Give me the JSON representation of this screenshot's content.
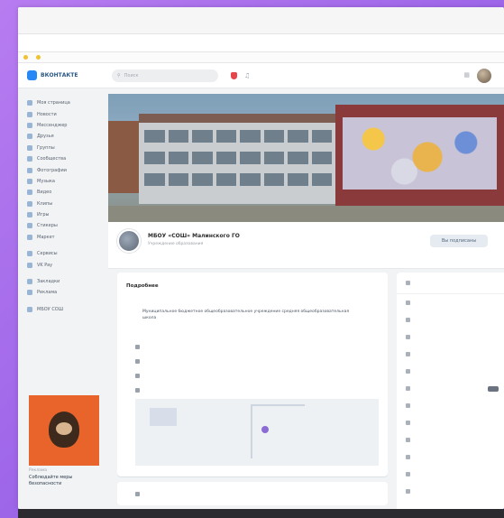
{
  "browser": {
    "address": "",
    "bookmarks": [
      "",
      ""
    ]
  },
  "header": {
    "logo_text": "ВКОНТАКТЕ",
    "search_placeholder": "Поиск"
  },
  "sidebar": {
    "items": [
      {
        "label": "Моя страница",
        "icon": "user-icon"
      },
      {
        "label": "Новости",
        "icon": "news-icon"
      },
      {
        "label": "Мессенджер",
        "icon": "chat-icon"
      },
      {
        "label": "Друзья",
        "icon": "friends-icon"
      },
      {
        "label": "Группы",
        "icon": "group-icon"
      },
      {
        "label": "Сообщества",
        "icon": "community-icon"
      },
      {
        "label": "Фотографии",
        "icon": "photo-icon"
      },
      {
        "label": "Музыка",
        "icon": "music-icon"
      },
      {
        "label": "Видео",
        "icon": "video-icon"
      },
      {
        "label": "Клипы",
        "icon": "clips-icon"
      },
      {
        "label": "Игры",
        "icon": "games-icon"
      },
      {
        "label": "Стикеры",
        "icon": "sticker-icon"
      },
      {
        "label": "Маркет",
        "icon": "market-icon"
      }
    ],
    "group2": [
      {
        "label": "Сервисы",
        "icon": "apps-icon"
      },
      {
        "label": "VK Pay",
        "icon": "wallet-icon"
      }
    ],
    "group3": [
      {
        "label": "Закладки",
        "icon": "bookmark-icon"
      },
      {
        "label": "Реклама",
        "icon": "ads-icon"
      }
    ],
    "extra": {
      "label": "МБОУ СОШ",
      "icon": "school-icon"
    }
  },
  "promo": {
    "caption": "Реклама",
    "text": "Соблюдайте меры безопасности"
  },
  "profile": {
    "name": "МБОУ «СОШ» Малинского ГО",
    "subtitle": "Учреждение образования",
    "status": "",
    "button_label": "Вы подписаны"
  },
  "info": {
    "title": "Подробнее",
    "description": "Муниципальное бюджетное общеобразовательное учреждение средняя общеобразовательная школа",
    "rows": [
      {
        "text": "",
        "icon": "link-icon"
      },
      {
        "text": "",
        "icon": "phone-icon"
      },
      {
        "text": "",
        "icon": "mail-icon"
      },
      {
        "text": "",
        "icon": "location-icon"
      }
    ],
    "map_label": "",
    "map_caption": ""
  },
  "info2": {
    "text": "",
    "icon": "info-icon"
  },
  "right_panel": {
    "items": [
      {
        "label": "",
        "icon": "users-icon"
      },
      {
        "label": "",
        "icon": "photo-icon"
      },
      {
        "label": "",
        "icon": "video-icon"
      },
      {
        "label": "",
        "icon": "music-icon"
      },
      {
        "label": "",
        "icon": "file-icon"
      },
      {
        "label": "",
        "icon": "link-icon"
      },
      {
        "label": "",
        "icon": "topic-icon"
      },
      {
        "label": "",
        "icon": "event-icon"
      },
      {
        "label": "",
        "icon": "contact-icon"
      },
      {
        "label": "",
        "icon": "article-icon"
      },
      {
        "label": "",
        "icon": "bookmark-icon"
      },
      {
        "label": "",
        "icon": "product-icon"
      },
      {
        "label": "",
        "icon": "service-icon"
      }
    ]
  },
  "colors": {
    "accent": "#2787f5",
    "link": "#2a5885",
    "background_gradient": "#9b63e8"
  }
}
